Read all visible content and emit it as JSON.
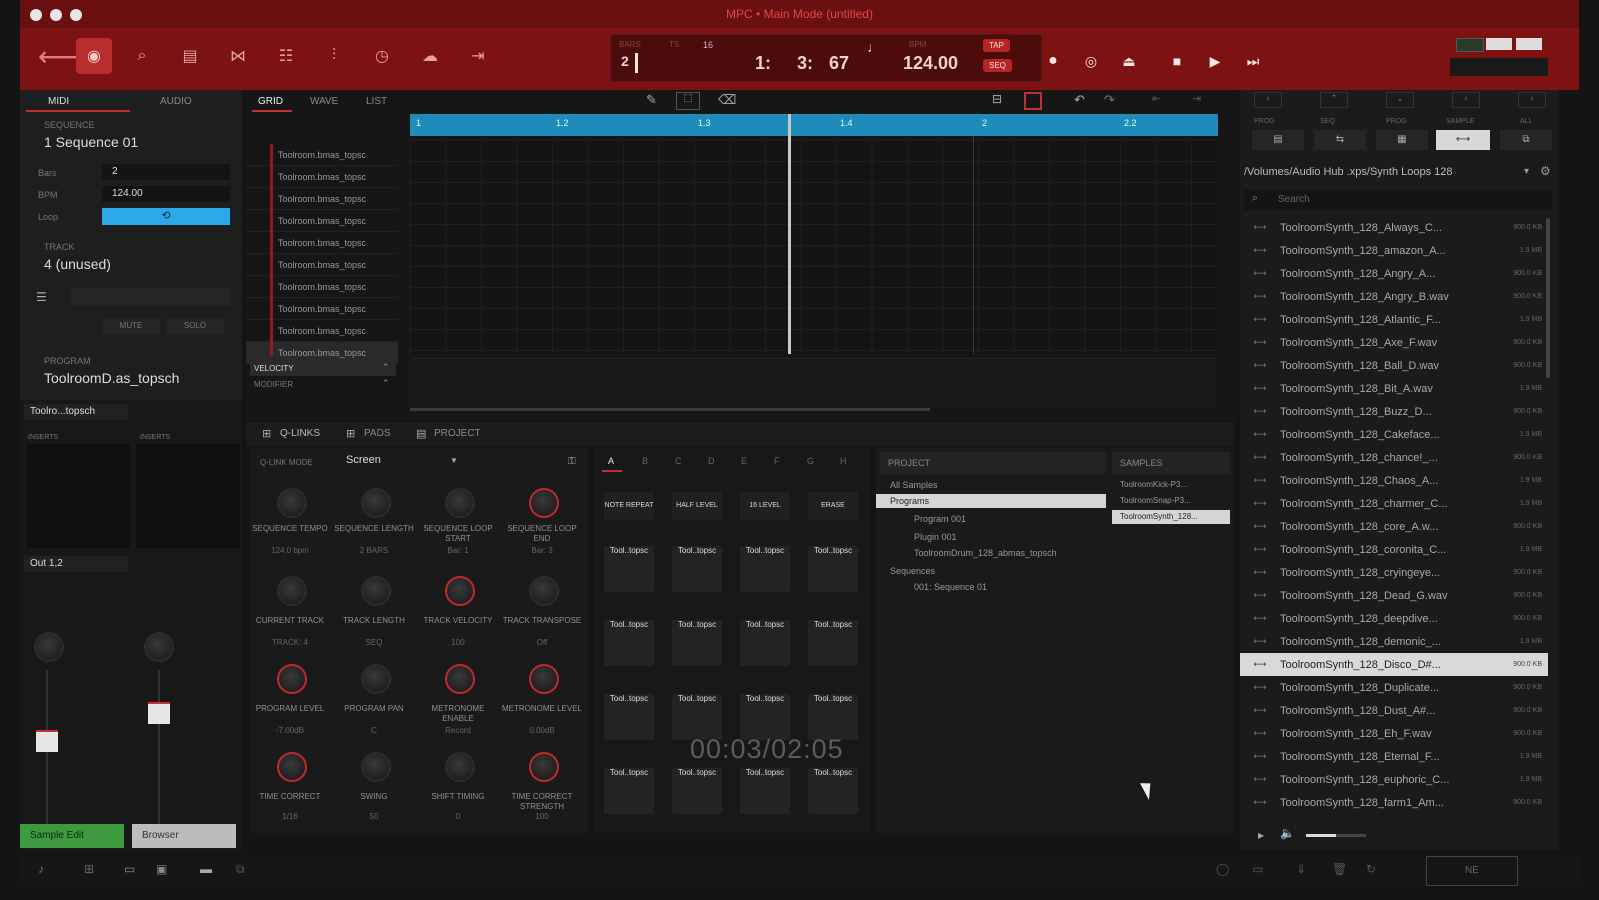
{
  "app": {
    "window_title": "MPC • Main Mode (untitled)"
  },
  "toolbar": {
    "icons": [
      "back-icon",
      "record-mode-icon",
      "browser-icon",
      "sample-edit-icon",
      "pad-mixer-icon",
      "channel-mixer-icon",
      "sliders-icon",
      "timer-icon",
      "cloud-icon",
      "settings-icon"
    ]
  },
  "lcd": {
    "bars_label": "BARS",
    "bars_value": "2",
    "sig_label": "TS",
    "sig_value": "16",
    "pos_bar": "1:",
    "pos_beat": "3:",
    "pos_tick": "67",
    "bpm_label": "BPM",
    "bpm_value": "124.00",
    "tap_label": "TAP",
    "seq_label": "SEQ"
  },
  "left_tabs": {
    "midi": "MIDI",
    "audio": "AUDIO"
  },
  "sequence": {
    "section": "SEQUENCE",
    "name": "1 Sequence 01",
    "bars_label": "Bars",
    "bars_value": "2",
    "bpm_label": "BPM",
    "bpm_value": "124.00",
    "loop_label": "Loop"
  },
  "track": {
    "section": "TRACK",
    "name": "4 (unused)",
    "mute": "MUTE",
    "solo": "SOLO"
  },
  "program": {
    "section": "PROGRAM",
    "name": "ToolroomD.as_topsch",
    "selector": "Toolro...topsch"
  },
  "mixer": {
    "inserts": "INSERTS",
    "output": "Out 1,2"
  },
  "grid_tabs": {
    "grid": "GRID",
    "wave": "WAVE",
    "list": "LIST"
  },
  "timeline": {
    "markers": [
      "1",
      "1.2",
      "1.3",
      "1.4",
      "2",
      "2.2"
    ]
  },
  "grid_rows": [
    "Toolroom.bmas_topsc",
    "Toolroom.bmas_topsc",
    "Toolroom.bmas_topsc",
    "Toolroom.bmas_topsc",
    "Toolroom.bmas_topsc",
    "Toolroom.bmas_topsc",
    "Toolroom.bmas_topsc",
    "Toolroom.bmas_topsc",
    "Toolroom.bmas_topsc",
    "Toolroom.bmas_topsc"
  ],
  "lanes": {
    "velocity": "VELOCITY",
    "modifier": "MODIFIER"
  },
  "bottom_tabs": {
    "qlinks": "Q-LINKS",
    "pads": "PADS",
    "project": "PROJECT"
  },
  "qlink": {
    "mode_label": "Q-LINK MODE",
    "mode_value": "Screen",
    "knobs": [
      {
        "label": "SEQUENCE TEMPO",
        "value": "124.0 bpm"
      },
      {
        "label": "SEQUENCE LENGTH",
        "value": "2 BARS"
      },
      {
        "label": "SEQUENCE LOOP START",
        "value": "Bar: 1"
      },
      {
        "label": "SEQUENCE LOOP END",
        "value": "Bar: 3"
      },
      {
        "label": "CURRENT TRACK",
        "value": "TRACK: 4"
      },
      {
        "label": "TRACK LENGTH",
        "value": "SEQ"
      },
      {
        "label": "TRACK VELOCITY",
        "value": "100"
      },
      {
        "label": "TRACK TRANSPOSE",
        "value": "Off"
      },
      {
        "label": "PROGRAM LEVEL",
        "value": "-7.00dB"
      },
      {
        "label": "PROGRAM PAN",
        "value": "C"
      },
      {
        "label": "METRONOME ENABLE",
        "value": "Record"
      },
      {
        "label": "METRONOME LEVEL",
        "value": "0.00dB"
      },
      {
        "label": "TIME CORRECT",
        "value": "1/16"
      },
      {
        "label": "SWING",
        "value": "50"
      },
      {
        "label": "SHIFT TIMING",
        "value": "0"
      },
      {
        "label": "TIME CORRECT STRENGTH",
        "value": "100"
      }
    ]
  },
  "pads": {
    "banks": [
      "A",
      "B",
      "C",
      "D",
      "E",
      "F",
      "G",
      "H"
    ],
    "buttons": [
      "NOTE REPEAT",
      "HALF LEVEL",
      "16 LEVEL",
      "ERASE"
    ],
    "pad_label": "Tool..topsc"
  },
  "project": {
    "header": "PROJECT",
    "samples_header": "SAMPLES",
    "tree": [
      "All Samples",
      "Programs",
      "Program 001",
      "Plugin 001",
      "ToolroomDrum_128_abmas_topsch",
      "Sequences",
      "001: Sequence 01"
    ],
    "samples": [
      "ToolroomKick-P3...",
      "ToolroomSnap-P3...",
      "ToolroomSynth_128..."
    ]
  },
  "timer": "00:03/02:05",
  "browser": {
    "tabs": [
      "PROG",
      "SEQ",
      "PROG",
      "SAMPLE",
      "ALL"
    ],
    "path": "/Volumes/Audio Hub .xps/Synth Loops 128",
    "search_placeholder": "Search",
    "items": [
      {
        "name": "ToolroomSynth_128_Always_C...",
        "size": "900.0 KB"
      },
      {
        "name": "ToolroomSynth_128_amazon_A...",
        "size": "1.9 MB"
      },
      {
        "name": "ToolroomSynth_128_Angry_A...",
        "size": "900.0 KB"
      },
      {
        "name": "ToolroomSynth_128_Angry_B.wav",
        "size": "900.0 KB"
      },
      {
        "name": "ToolroomSynth_128_Atlantic_F...",
        "size": "1.9 MB"
      },
      {
        "name": "ToolroomSynth_128_Axe_F.wav",
        "size": "900.0 KB"
      },
      {
        "name": "ToolroomSynth_128_Ball_D.wav",
        "size": "900.0 KB"
      },
      {
        "name": "ToolroomSynth_128_Bit_A.wav",
        "size": "1.9 MB"
      },
      {
        "name": "ToolroomSynth_128_Buzz_D...",
        "size": "900.0 KB"
      },
      {
        "name": "ToolroomSynth_128_Cakeface...",
        "size": "1.9 MB"
      },
      {
        "name": "ToolroomSynth_128_chance!_...",
        "size": "900.0 KB"
      },
      {
        "name": "ToolroomSynth_128_Chaos_A...",
        "size": "1.9 MB"
      },
      {
        "name": "ToolroomSynth_128_charmer_C...",
        "size": "1.9 MB"
      },
      {
        "name": "ToolroomSynth_128_core_A.w...",
        "size": "900.0 KB"
      },
      {
        "name": "ToolroomSynth_128_coronita_C...",
        "size": "1.9 MB"
      },
      {
        "name": "ToolroomSynth_128_cryingeye...",
        "size": "900.0 KB"
      },
      {
        "name": "ToolroomSynth_128_Dead_G.wav",
        "size": "900.0 KB"
      },
      {
        "name": "ToolroomSynth_128_deepdive...",
        "size": "900.0 KB"
      },
      {
        "name": "ToolroomSynth_128_demonic_...",
        "size": "1.9 MB"
      },
      {
        "name": "ToolroomSynth_128_Disco_D#...",
        "size": "900.0 KB"
      },
      {
        "name": "ToolroomSynth_128_Duplicate...",
        "size": "900.0 KB"
      },
      {
        "name": "ToolroomSynth_128_Dust_A#...",
        "size": "900.0 KB"
      },
      {
        "name": "ToolroomSynth_128_Eh_F.wav",
        "size": "900.0 KB"
      },
      {
        "name": "ToolroomSynth_128_Eternal_F...",
        "size": "1.9 MB"
      },
      {
        "name": "ToolroomSynth_128_euphoric_C...",
        "size": "1.9 MB"
      },
      {
        "name": "ToolroomSynth_128_farm1_Am...",
        "size": "900.0 KB"
      }
    ]
  },
  "status_chips": {
    "left": "Sample Edit",
    "right": "Browser"
  }
}
